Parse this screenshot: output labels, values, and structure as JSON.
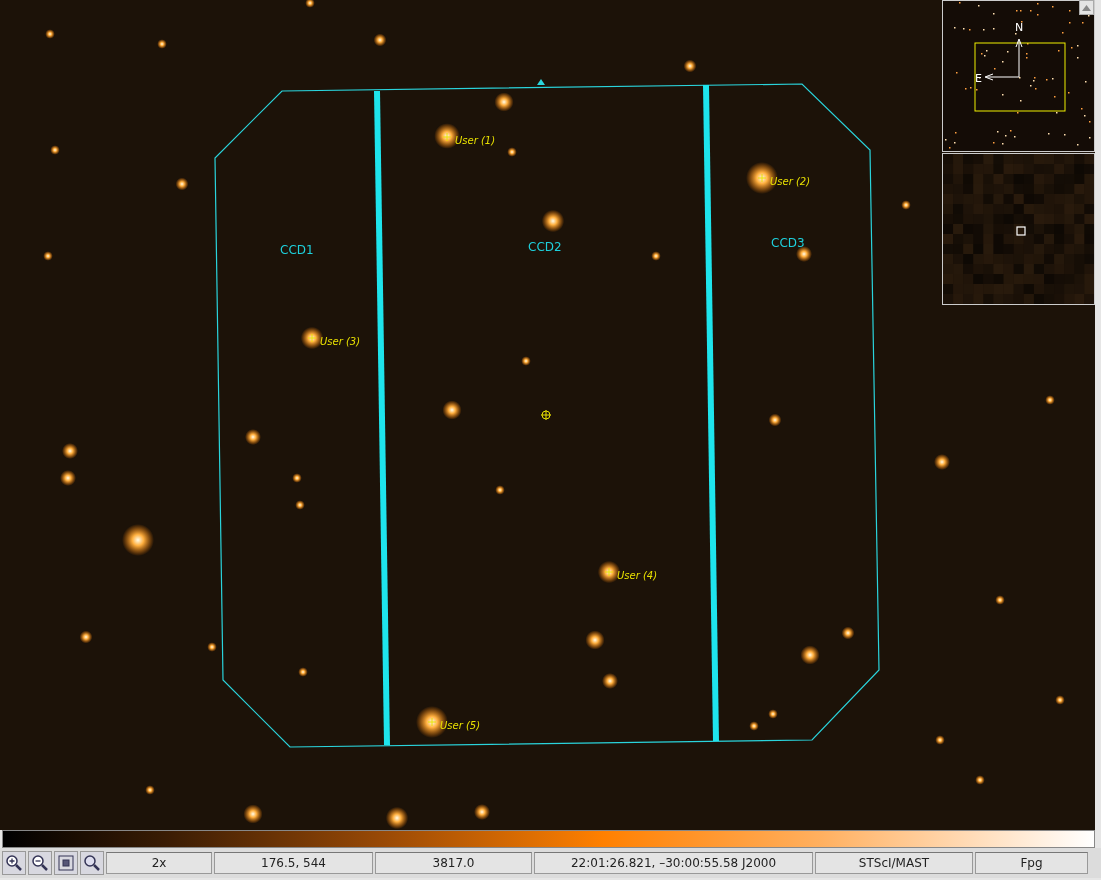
{
  "image": {
    "ccds": [
      {
        "label": "CCD1"
      },
      {
        "label": "CCD2"
      },
      {
        "label": "CCD3"
      }
    ],
    "markers": [
      {
        "label": "User (1)"
      },
      {
        "label": "User (2)"
      },
      {
        "label": "User (3)"
      },
      {
        "label": "User (4)"
      },
      {
        "label": "User (5)"
      }
    ]
  },
  "overview": {
    "compass": {
      "north": "N",
      "east": "E"
    }
  },
  "status_bar": {
    "tools": [
      {
        "kind": "zoom_in"
      },
      {
        "kind": "zoom_out"
      },
      {
        "kind": "fit"
      },
      {
        "kind": "zoom"
      }
    ],
    "fields": [
      {
        "kind": "zoom",
        "text": "2x"
      },
      {
        "kind": "pixel",
        "text": "176.5, 544"
      },
      {
        "kind": "value",
        "text": "3817.0"
      },
      {
        "kind": "coordinates",
        "text": "22:01:26.821, –30:00:55.58 J2000"
      },
      {
        "kind": "survey",
        "text": "STScI/MAST"
      },
      {
        "kind": "band",
        "text": "Fpg"
      }
    ]
  }
}
